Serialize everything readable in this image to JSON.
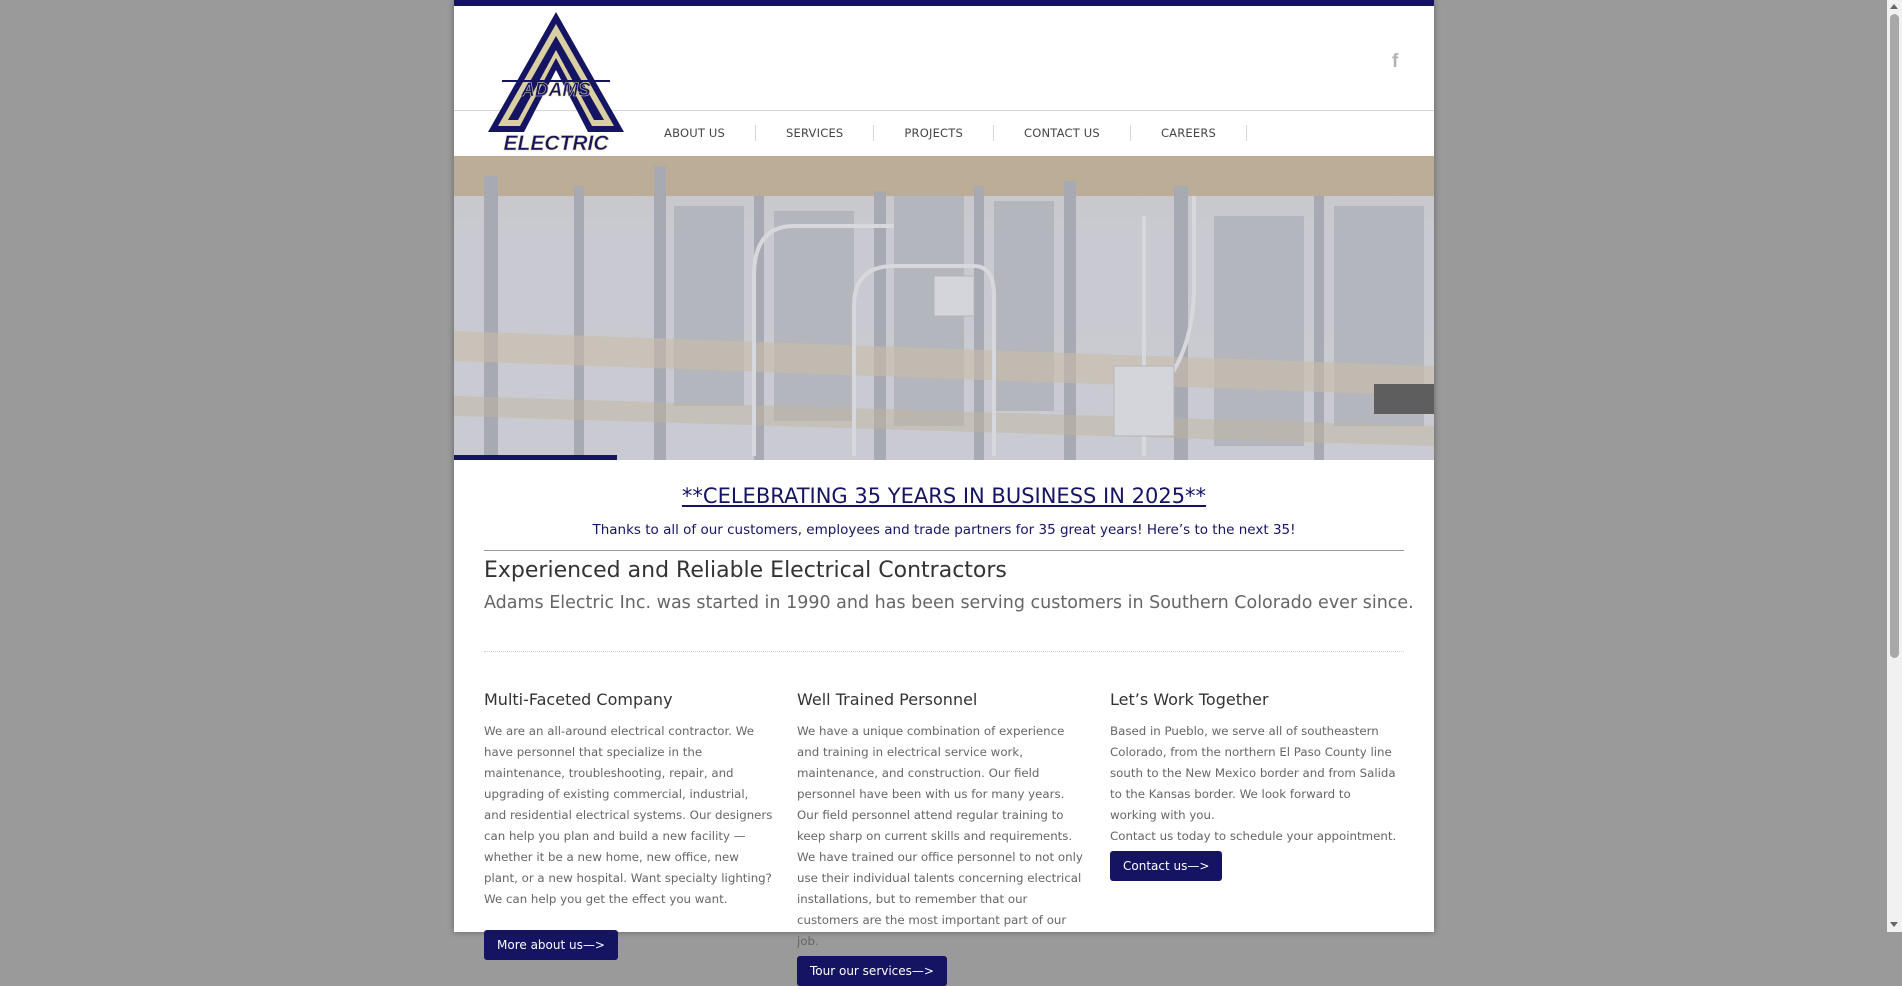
{
  "header": {
    "logo_text_top": "ADAMS",
    "logo_text_bottom": "ELECTRIC",
    "social_icon": "facebook-icon",
    "social_glyph": "f"
  },
  "nav": {
    "items": [
      {
        "label": "ABOUT US"
      },
      {
        "label": "SERVICES"
      },
      {
        "label": "PROJECTS"
      },
      {
        "label": "CONTACT US"
      },
      {
        "label": "CAREERS"
      }
    ]
  },
  "hero": {
    "progress": 0.166
  },
  "banner": {
    "headline": "**CELEBRATING 35 YEARS IN BUSINESS IN 2025**",
    "subline": "Thanks to all of our customers, employees and trade partners for 35 great years! Here’s to the next 35!"
  },
  "intro": {
    "title": "Experienced and Reliable Electrical Contractors",
    "lead": "Adams Electric Inc. was started in 1990 and has been serving customers in Southern Colorado ever since."
  },
  "columns": [
    {
      "title": "Multi-Faceted Company",
      "body": "We are an all-around electrical contractor. We have personnel that specialize in the maintenance, troubleshooting, repair, and upgrading of existing commercial, industrial, and residential electrical systems. Our designers can help you plan and build a new facility — whether it be a new home, new office, new plant, or a new hospital. Want specialty lighting? We can help you get the effect you want.",
      "button": "More about us—>"
    },
    {
      "title": "Well Trained Personnel",
      "body": "We have a unique combination of experience and training in electrical service work, maintenance, and construction. Our field personnel have been with us for many years. Our field personnel attend regular training to keep sharp on current skills and requirements. We have trained our office personnel to not only use their individual talents concerning electrical installations, but to remember that our customers are the most important part of our job.",
      "button": "Tour our services—>"
    },
    {
      "title": "Let’s Work Together",
      "body": "Based in Pueblo, we serve all of southeastern Colorado, from the northern El Paso County line south to the New Mexico border and from Salida to the Kansas border. We look forward to working with you.",
      "body2": "Contact us today to schedule your appointment.",
      "button": "Contact us—>"
    }
  ],
  "colors": {
    "brand_navy": "#141463",
    "page_bg": "#9a9a9a"
  }
}
